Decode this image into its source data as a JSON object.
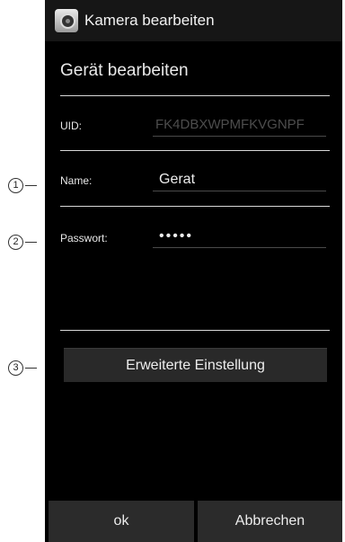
{
  "window": {
    "title": "Kamera bearbeiten"
  },
  "dialog": {
    "title": "Gerät bearbeiten",
    "uid": {
      "label": "UID:",
      "value": "FK4DBXWPMFKVGNPF"
    },
    "name": {
      "label": "Name:",
      "value": "Gerat"
    },
    "password": {
      "label": "Passwort:",
      "value": "•••••"
    },
    "advanced_button": "Erweiterte Einstellung",
    "ok_button": "ok",
    "cancel_button": "Abbrechen"
  },
  "callouts": [
    "1",
    "2",
    "3"
  ],
  "icons": {
    "app": "camera-app-icon"
  },
  "colors": {
    "background": "#000000",
    "button": "#2b2b2b",
    "text": "#eeeeee",
    "disabled_text": "#4d4d4d"
  }
}
